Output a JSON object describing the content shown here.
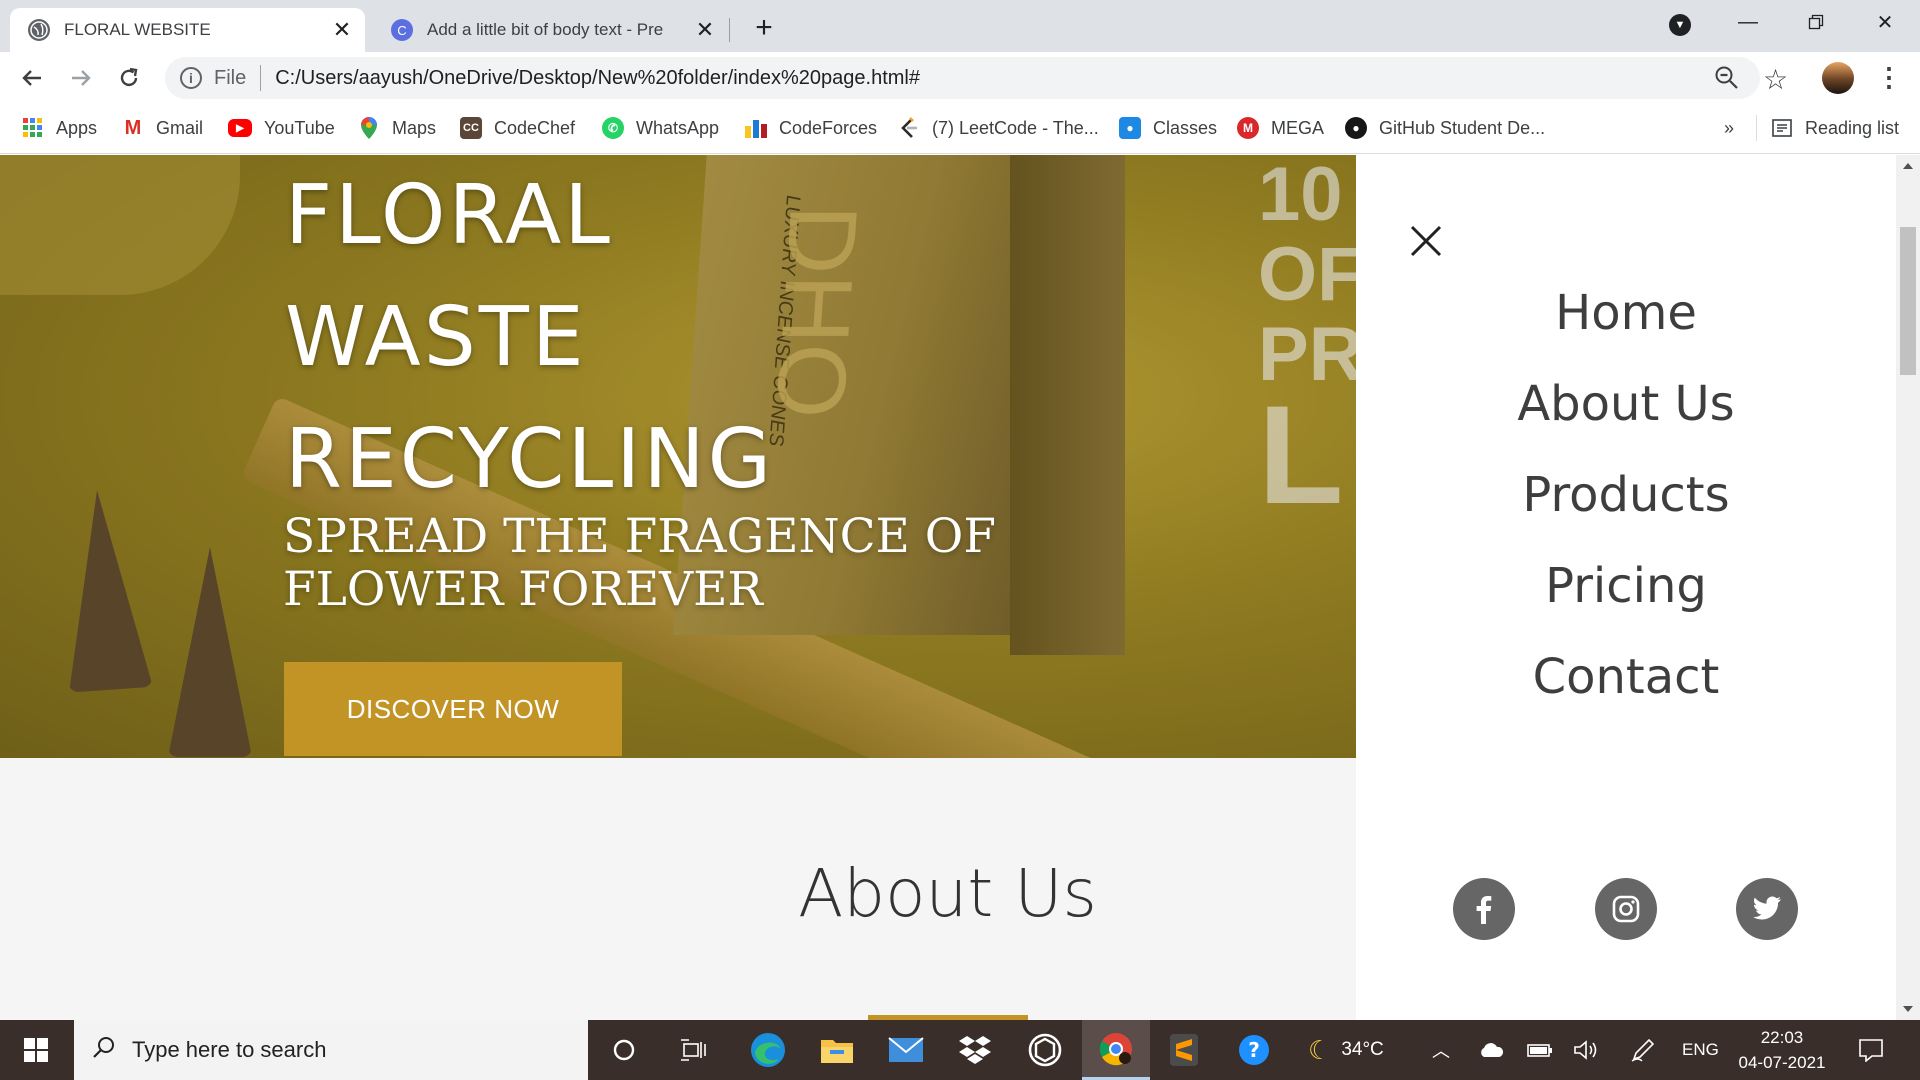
{
  "browser": {
    "tabs": [
      {
        "title": "FLORAL WEBSITE",
        "icon": "globe-icon",
        "active": true
      },
      {
        "title": "Add a little bit of body text - Pre",
        "icon": "canva-icon",
        "active": false
      }
    ],
    "address": {
      "scheme": "File",
      "url": "C:/Users/aayush/OneDrive/Desktop/New%20folder/index%20page.html#"
    },
    "bookmarks": [
      {
        "label": "Apps",
        "icon": "apps-grid-icon"
      },
      {
        "label": "Gmail",
        "icon": "gmail-icon"
      },
      {
        "label": "YouTube",
        "icon": "youtube-icon"
      },
      {
        "label": "Maps",
        "icon": "maps-pin-icon"
      },
      {
        "label": "CodeChef",
        "icon": "codechef-icon"
      },
      {
        "label": "WhatsApp",
        "icon": "whatsapp-icon"
      },
      {
        "label": "CodeForces",
        "icon": "codeforces-icon"
      },
      {
        "label": "(7) LeetCode - The...",
        "icon": "leetcode-icon"
      },
      {
        "label": "Classes",
        "icon": "classroom-icon"
      },
      {
        "label": "MEGA",
        "icon": "mega-icon"
      },
      {
        "label": "GitHub Student De...",
        "icon": "github-icon"
      }
    ],
    "bookmarks_more": "»",
    "reading_list": "Reading list"
  },
  "hero": {
    "title_lines": [
      "FLORAL",
      "WASTE",
      "RECYCLING"
    ],
    "subtitle": "SPREAD THE FRAGENCE OF FLOWER FOREVER",
    "cta_label": "DISCOVER NOW",
    "background_text": [
      "10",
      "OF",
      "PR",
      "L"
    ],
    "box_print": [
      "LUXURY INCENSE CONES",
      "DHO"
    ]
  },
  "about": {
    "heading": "About Us"
  },
  "side_menu": {
    "links": [
      "Home",
      "About Us",
      "Products",
      "Pricing",
      "Contact"
    ],
    "social": [
      "facebook-icon",
      "instagram-icon",
      "twitter-icon"
    ]
  },
  "taskbar": {
    "search_placeholder": "Type here to search",
    "weather": "34°C",
    "language": "ENG",
    "time": "22:03",
    "date": "04-07-2021"
  },
  "colors": {
    "accent": "#c29426",
    "tabstrip": "#dee1e6",
    "taskbar": "#3a2e2a",
    "menu_text": "#3e3e3e",
    "social_bg": "#666666"
  }
}
